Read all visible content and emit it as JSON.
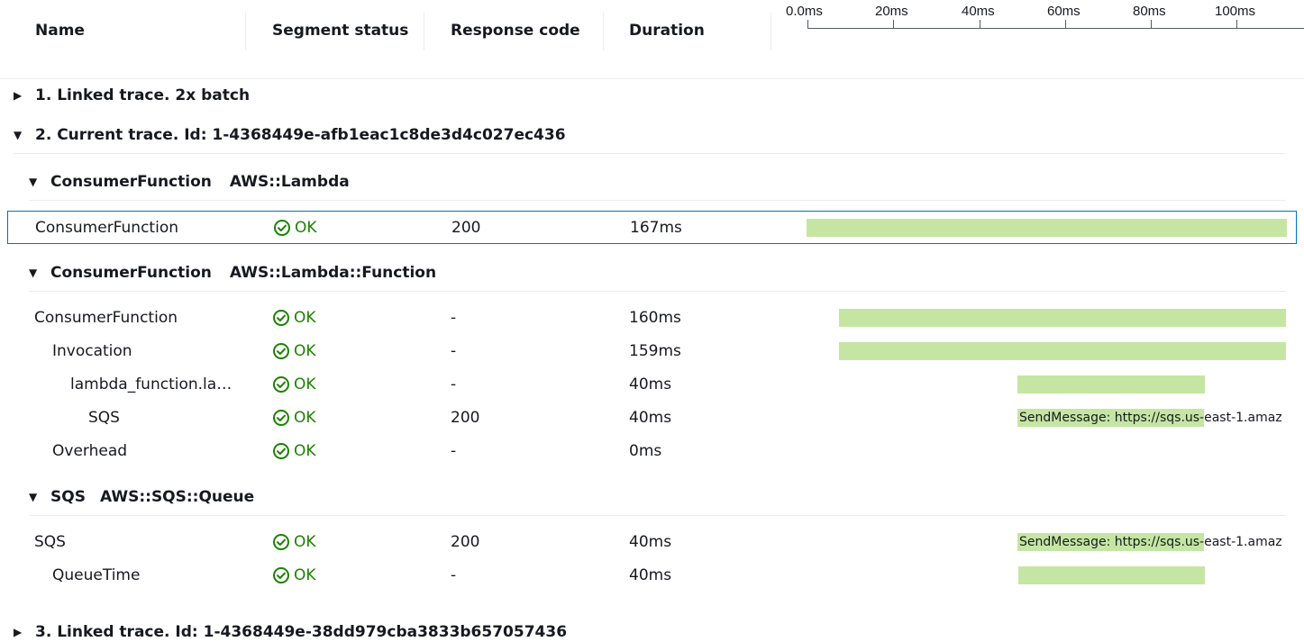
{
  "header": {
    "name": "Name",
    "segment_status": "Segment status",
    "response_code": "Response code",
    "duration": "Duration",
    "ticks": [
      "0.0ms",
      "20ms",
      "40ms",
      "60ms",
      "80ms",
      "100ms"
    ]
  },
  "groups": {
    "linked1": "1. Linked trace. 2x batch",
    "current": "2. Current trace. Id: 1-4368449e-afb1eac1c8de3d4c027ec436",
    "linked3": "3. Linked trace. Id: 1-4368449e-38dd979cba3833b657057436"
  },
  "subgroups": {
    "lambda": {
      "name": "ConsumerFunction",
      "type": "AWS::Lambda"
    },
    "function": {
      "name": "ConsumerFunction",
      "type": "AWS::Lambda::Function"
    },
    "sqs": {
      "name": "SQS",
      "type": "AWS::SQS::Queue"
    }
  },
  "rows": {
    "r1": {
      "name": "ConsumerFunction",
      "status": "OK",
      "code": "200",
      "duration": "167ms"
    },
    "r2": {
      "name": "ConsumerFunction",
      "status": "OK",
      "code": "-",
      "duration": "160ms"
    },
    "r3": {
      "name": "Invocation",
      "status": "OK",
      "code": "-",
      "duration": "159ms"
    },
    "r4": {
      "name": "lambda_function.la…",
      "status": "OK",
      "code": "-",
      "duration": "40ms"
    },
    "r5": {
      "name": "SQS",
      "status": "OK",
      "code": "200",
      "duration": "40ms",
      "bar_label": "SendMessage: https://sqs.us-east-1.amaz"
    },
    "r6": {
      "name": "Overhead",
      "status": "OK",
      "code": "-",
      "duration": "0ms"
    },
    "r7": {
      "name": "SQS",
      "status": "OK",
      "code": "200",
      "duration": "40ms",
      "bar_label": "SendMessage: https://sqs.us-east-1.amaz"
    },
    "r8": {
      "name": "QueueTime",
      "status": "OK",
      "code": "-",
      "duration": "40ms"
    }
  },
  "colors": {
    "ok": "#1d8102",
    "bar": "#c5e6a3",
    "selected_border": "#0073bb"
  }
}
